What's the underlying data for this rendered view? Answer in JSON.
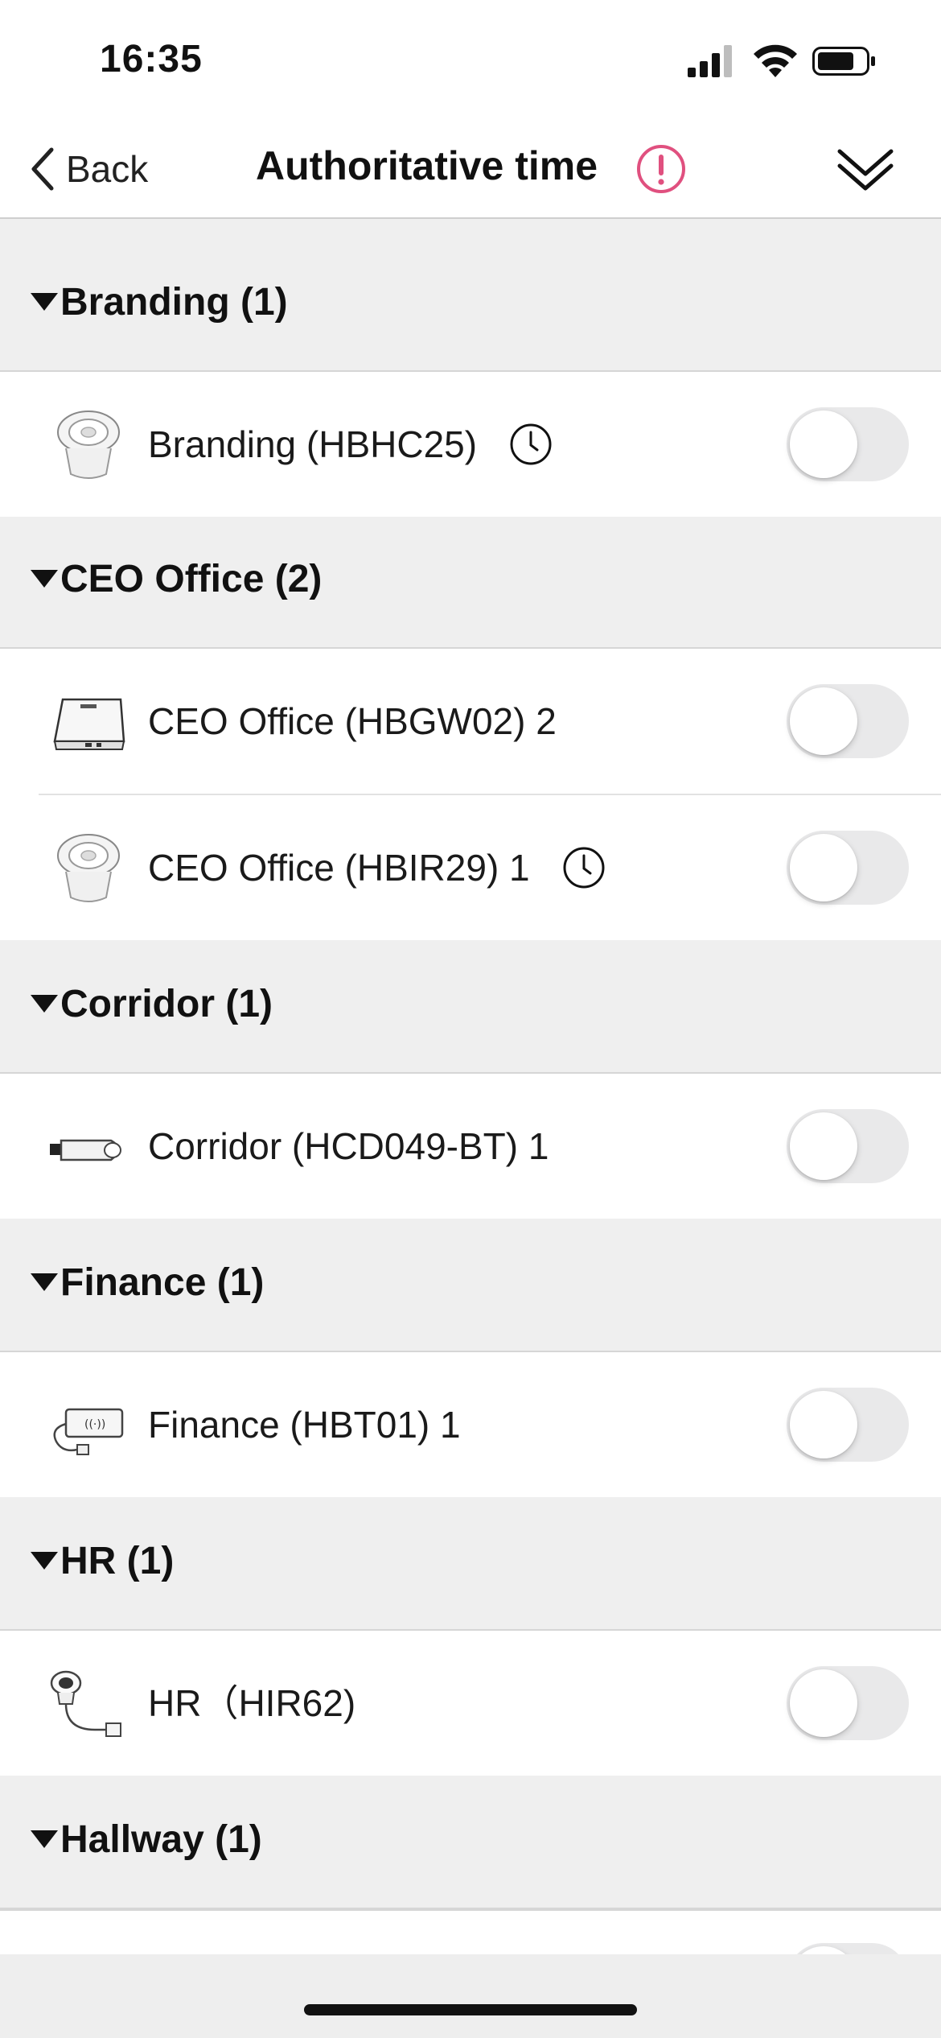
{
  "status_bar": {
    "time": "16:35"
  },
  "nav": {
    "back_label": "Back",
    "title": "Authoritative time",
    "alert_color": "#e0507f"
  },
  "groups": [
    {
      "label": "Branding (1)",
      "devices": [
        {
          "label": "Branding (HBHC25)",
          "icon": "ceiling-sensor-icon",
          "clock": true,
          "enabled": false
        }
      ]
    },
    {
      "label": "CEO Office (2)",
      "devices": [
        {
          "label": "CEO Office (HBGW02) 2",
          "icon": "gateway-box-icon",
          "clock": false,
          "enabled": false
        },
        {
          "label": "CEO Office (HBIR29) 1",
          "icon": "ceiling-sensor-icon",
          "clock": true,
          "enabled": false
        }
      ]
    },
    {
      "label": "Corridor (1)",
      "devices": [
        {
          "label": "Corridor (HCD049-BT) 1",
          "icon": "bluetooth-dongle-icon",
          "clock": false,
          "enabled": false
        }
      ]
    },
    {
      "label": "Finance (1)",
      "devices": [
        {
          "label": "Finance (HBT01) 1",
          "icon": "transmitter-module-icon",
          "clock": false,
          "enabled": false
        }
      ]
    },
    {
      "label": "HR (1)",
      "devices": [
        {
          "label": "HR（HIR62)",
          "icon": "ir-sensor-cable-icon",
          "clock": false,
          "enabled": false
        }
      ]
    },
    {
      "label": "Hallway (1)",
      "devices": []
    }
  ]
}
